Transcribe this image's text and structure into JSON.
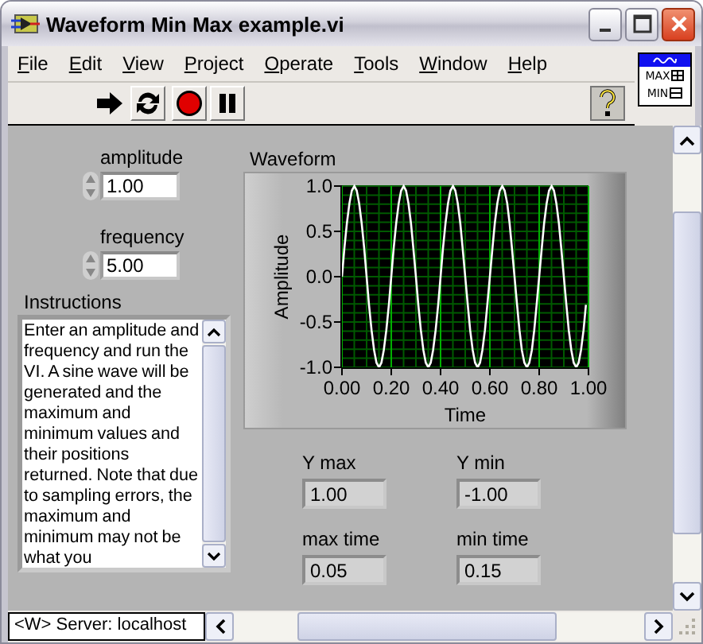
{
  "window": {
    "title": "Waveform Min Max example.vi"
  },
  "menu": [
    "File",
    "Edit",
    "View",
    "Project",
    "Operate",
    "Tools",
    "Window",
    "Help"
  ],
  "vi_icon": {
    "top_text": "MAX",
    "bottom_text": "MIN"
  },
  "controls": [
    {
      "label": "amplitude",
      "value": "1.00"
    },
    {
      "label": "frequency",
      "value": "5.00"
    }
  ],
  "instructions": {
    "label": "Instructions",
    "text": "Enter an amplitude and frequency and run the VI.  A sine wave will be generated and the maximum and minimum values and their positions returned. Note that due to sampling errors, the maximum and minimum may not be what you"
  },
  "graph": {
    "label": "Waveform",
    "chart_data": {
      "type": "line",
      "xlabel": "Time",
      "ylabel": "Amplitude",
      "xlim": [
        0,
        1
      ],
      "ylim": [
        -1,
        1
      ],
      "xticks": [
        {
          "value": 0,
          "label": "0.00"
        },
        {
          "value": 0.2,
          "label": "0.20"
        },
        {
          "value": 0.4,
          "label": "0.40"
        },
        {
          "value": 0.6,
          "label": "0.60"
        },
        {
          "value": 0.8,
          "label": "0.80"
        },
        {
          "value": 1,
          "label": "1.00"
        }
      ],
      "yticks": [
        {
          "value": 1,
          "label": "1.0"
        },
        {
          "value": 0.5,
          "label": "0.5"
        },
        {
          "value": 0,
          "label": "0.0"
        },
        {
          "value": -0.5,
          "label": "-0.5"
        },
        {
          "value": -1,
          "label": "-1.0"
        }
      ],
      "x": [
        0,
        0.01,
        0.02,
        0.03,
        0.04,
        0.05,
        0.06,
        0.07,
        0.08,
        0.09,
        0.1,
        0.11,
        0.12,
        0.13,
        0.14,
        0.15,
        0.16,
        0.17,
        0.18,
        0.19,
        0.2,
        0.21,
        0.22,
        0.23,
        0.24,
        0.25,
        0.26,
        0.27,
        0.28,
        0.29,
        0.3,
        0.31,
        0.32,
        0.33,
        0.34,
        0.35,
        0.36,
        0.37,
        0.38,
        0.39,
        0.4,
        0.41,
        0.42,
        0.43,
        0.44,
        0.45,
        0.46,
        0.47,
        0.48,
        0.49,
        0.5,
        0.51,
        0.52,
        0.53,
        0.54,
        0.55,
        0.56,
        0.57,
        0.58,
        0.59,
        0.6,
        0.61,
        0.62,
        0.63,
        0.64,
        0.65,
        0.66,
        0.67,
        0.68,
        0.69,
        0.7,
        0.71,
        0.72,
        0.73,
        0.74,
        0.75,
        0.76,
        0.77,
        0.78,
        0.79,
        0.8,
        0.81,
        0.82,
        0.83,
        0.84,
        0.85,
        0.86,
        0.87,
        0.88,
        0.89,
        0.9,
        0.91,
        0.92,
        0.93,
        0.94,
        0.95,
        0.96,
        0.97,
        0.98,
        0.99
      ],
      "grid": true,
      "series": [
        {
          "color": "#ffffff",
          "values": [
            0,
            0.31,
            0.59,
            0.81,
            0.95,
            1,
            0.95,
            0.81,
            0.59,
            0.31,
            0,
            -0.31,
            -0.59,
            -0.81,
            -0.95,
            -1,
            -0.95,
            -0.81,
            -0.59,
            -0.31,
            0,
            0.31,
            0.59,
            0.81,
            0.95,
            1,
            0.95,
            0.81,
            0.59,
            0.31,
            0,
            -0.31,
            -0.59,
            -0.81,
            -0.95,
            -1,
            -0.95,
            -0.81,
            -0.59,
            -0.31,
            0,
            0.31,
            0.59,
            0.81,
            0.95,
            1,
            0.95,
            0.81,
            0.59,
            0.31,
            0,
            -0.31,
            -0.59,
            -0.81,
            -0.95,
            -1,
            -0.95,
            -0.81,
            -0.59,
            -0.31,
            0,
            0.31,
            0.59,
            0.81,
            0.95,
            1,
            0.95,
            0.81,
            0.59,
            0.31,
            0,
            -0.31,
            -0.59,
            -0.81,
            -0.95,
            -1,
            -0.95,
            -0.81,
            -0.59,
            -0.31,
            0,
            0.31,
            0.59,
            0.81,
            0.95,
            1,
            0.95,
            0.81,
            0.59,
            0.31,
            0,
            -0.31,
            -0.59,
            -0.81,
            -0.95,
            -1,
            -0.95,
            -0.81,
            -0.59,
            -0.31
          ]
        }
      ]
    }
  },
  "indicators": [
    {
      "label": "Y max",
      "value": "1.00"
    },
    {
      "label": "Y min",
      "value": "-1.00"
    },
    {
      "label": "max time",
      "value": "0.05"
    },
    {
      "label": "min time",
      "value": "0.15"
    }
  ],
  "status_bar": {
    "server": "<W> Server: localhost"
  }
}
